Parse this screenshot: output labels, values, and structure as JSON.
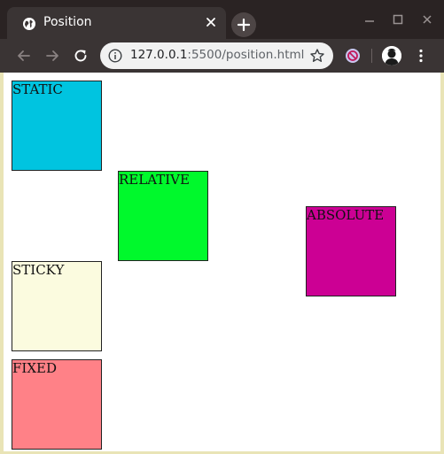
{
  "browser": {
    "tab": {
      "title": "Position"
    },
    "address_bar": {
      "host": "127.0.0.1",
      "rest": ":5500/position.html"
    }
  },
  "page": {
    "boxes": {
      "static": {
        "label": "STATIC",
        "color": "#00c4e0"
      },
      "relative": {
        "label": "RELATIVE",
        "color": "#00f92c"
      },
      "absolute": {
        "label": "ABSOLUTE",
        "color": "#cc0094"
      },
      "sticky": {
        "label": "STICKY",
        "color": "#fbfbdf"
      },
      "fixed": {
        "label": "FIXED",
        "color": "#ff8187"
      }
    }
  },
  "icons": {
    "tab_favicon": "globe-icon",
    "tab_close": "close-icon",
    "new_tab": "plus-icon",
    "window_minimize": "minimize-icon",
    "window_maximize": "maximize-icon",
    "window_close": "close-icon",
    "back": "arrow-left-icon",
    "forward": "arrow-right-icon",
    "reload": "reload-icon",
    "site_info": "info-icon",
    "bookmark": "star-icon",
    "extension": "block-icon",
    "profile": "avatar-icon",
    "menu": "kebab-menu-icon"
  }
}
